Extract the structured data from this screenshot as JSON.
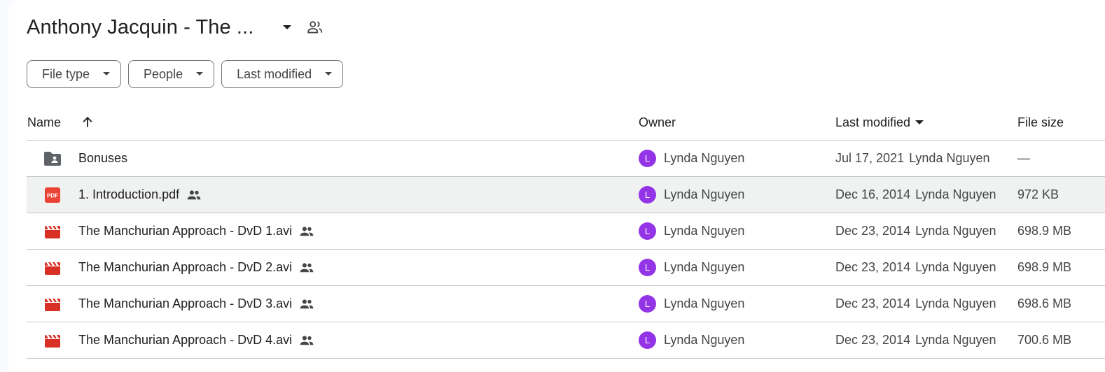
{
  "header": {
    "title": "Anthony Jacquin - The ...",
    "caret_icon": "arrow-drop-down-icon",
    "shared_icon": "people-outline-icon"
  },
  "filters": [
    {
      "label": "File type"
    },
    {
      "label": "People"
    },
    {
      "label": "Last modified"
    }
  ],
  "table": {
    "columns": {
      "name": "Name",
      "owner": "Owner",
      "last_modified": "Last modified",
      "file_size": "File size"
    },
    "sort_icon": "arrow-up-icon",
    "rows": [
      {
        "icon": "shared-folder-icon",
        "name": "Bonuses",
        "shared": false,
        "owner_initial": "L",
        "owner": "Lynda Nguyen",
        "modified_date": "Jul 17, 2021",
        "modified_by": "Lynda Nguyen",
        "size": "—"
      },
      {
        "icon": "pdf-icon",
        "name": "1. Introduction.pdf",
        "shared": true,
        "owner_initial": "L",
        "owner": "Lynda Nguyen",
        "modified_date": "Dec 16, 2014",
        "modified_by": "Lynda Nguyen",
        "size": "972 KB"
      },
      {
        "icon": "video-icon",
        "name": "The Manchurian Approach - DvD 1.avi",
        "shared": true,
        "owner_initial": "L",
        "owner": "Lynda Nguyen",
        "modified_date": "Dec 23, 2014",
        "modified_by": "Lynda Nguyen",
        "size": "698.9 MB"
      },
      {
        "icon": "video-icon",
        "name": "The Manchurian Approach - DvD 2.avi",
        "shared": true,
        "owner_initial": "L",
        "owner": "Lynda Nguyen",
        "modified_date": "Dec 23, 2014",
        "modified_by": "Lynda Nguyen",
        "size": "698.9 MB"
      },
      {
        "icon": "video-icon",
        "name": "The Manchurian Approach - DvD 3.avi",
        "shared": true,
        "owner_initial": "L",
        "owner": "Lynda Nguyen",
        "modified_date": "Dec 23, 2014",
        "modified_by": "Lynda Nguyen",
        "size": "698.6 MB"
      },
      {
        "icon": "video-icon",
        "name": "The Manchurian Approach - DvD 4.avi",
        "shared": true,
        "owner_initial": "L",
        "owner": "Lynda Nguyen",
        "modified_date": "Dec 23, 2014",
        "modified_by": "Lynda Nguyen",
        "size": "700.6 MB"
      }
    ]
  },
  "colors": {
    "avatar": "#9334e6",
    "pdf": "#ea4335",
    "video": "#d93025",
    "folder": "#5f6368",
    "selected_row": "#f0f1f1"
  }
}
